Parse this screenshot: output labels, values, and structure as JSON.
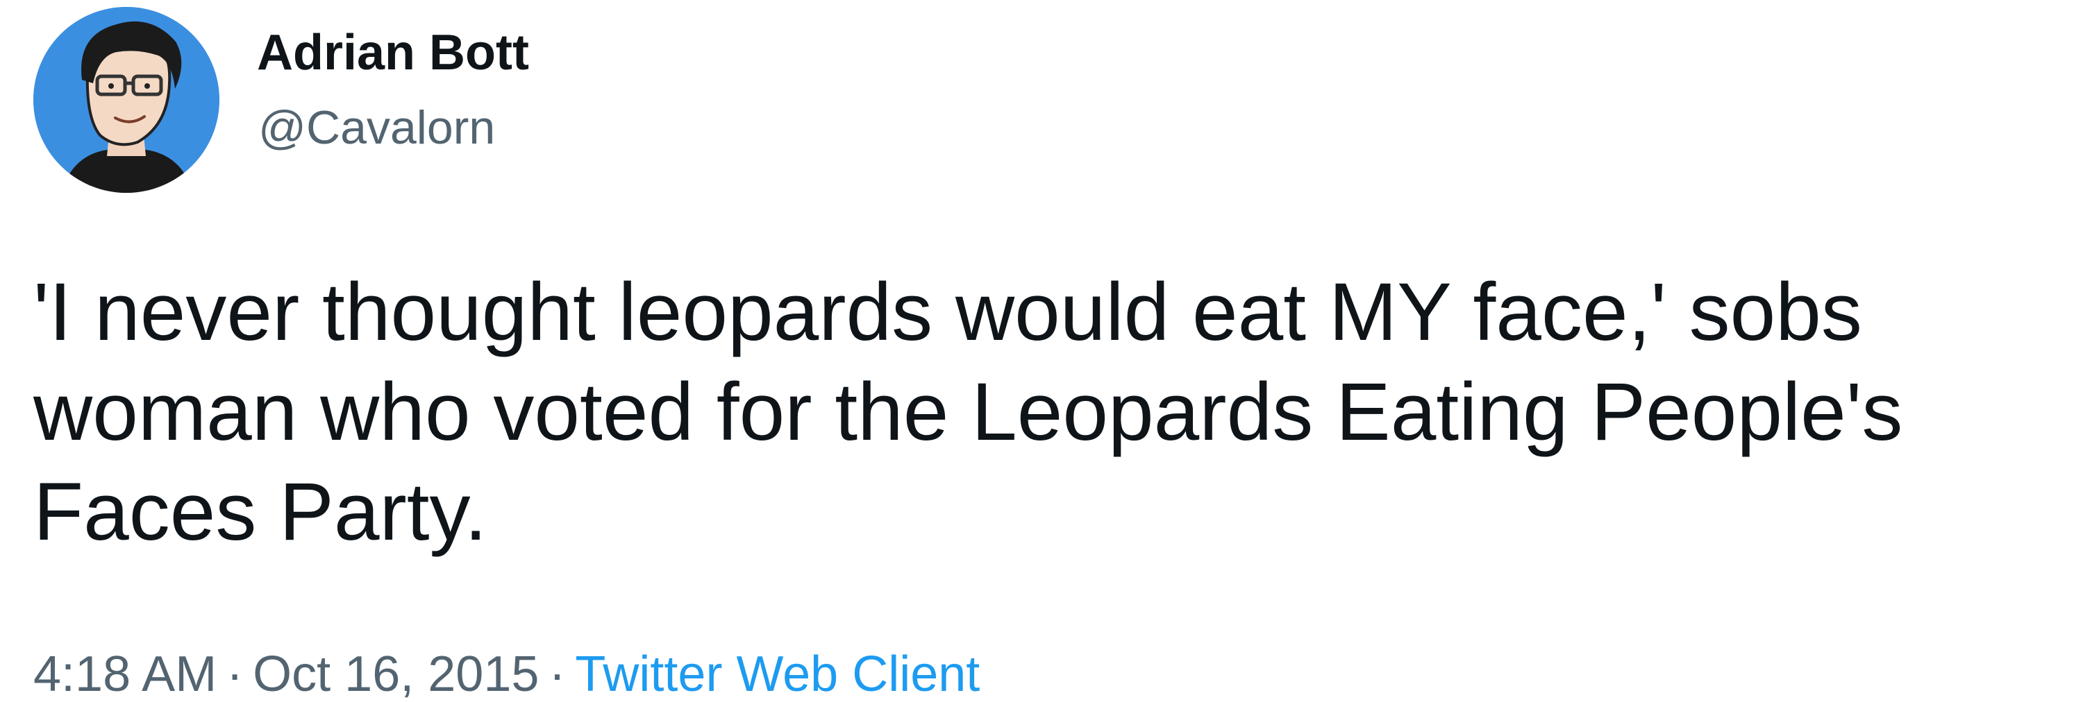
{
  "tweet": {
    "author": {
      "display_name": "Adrian Bott",
      "handle": "@Cavalorn",
      "avatar_icon": "cartoon-portrait-avatar"
    },
    "text_lines": [
      "'I never thought leopards would eat MY face,' sobs",
      "woman who voted for the Leopards Eating People's",
      "Faces Party."
    ],
    "meta": {
      "time": "4:18 AM",
      "separator": "·",
      "date": "Oct 16, 2015",
      "source": "Twitter Web Client"
    }
  },
  "colors": {
    "text": "#0f1419",
    "secondary": "#536471",
    "link": "#1d9bf0",
    "avatar_bg": "#3b8fe0"
  }
}
